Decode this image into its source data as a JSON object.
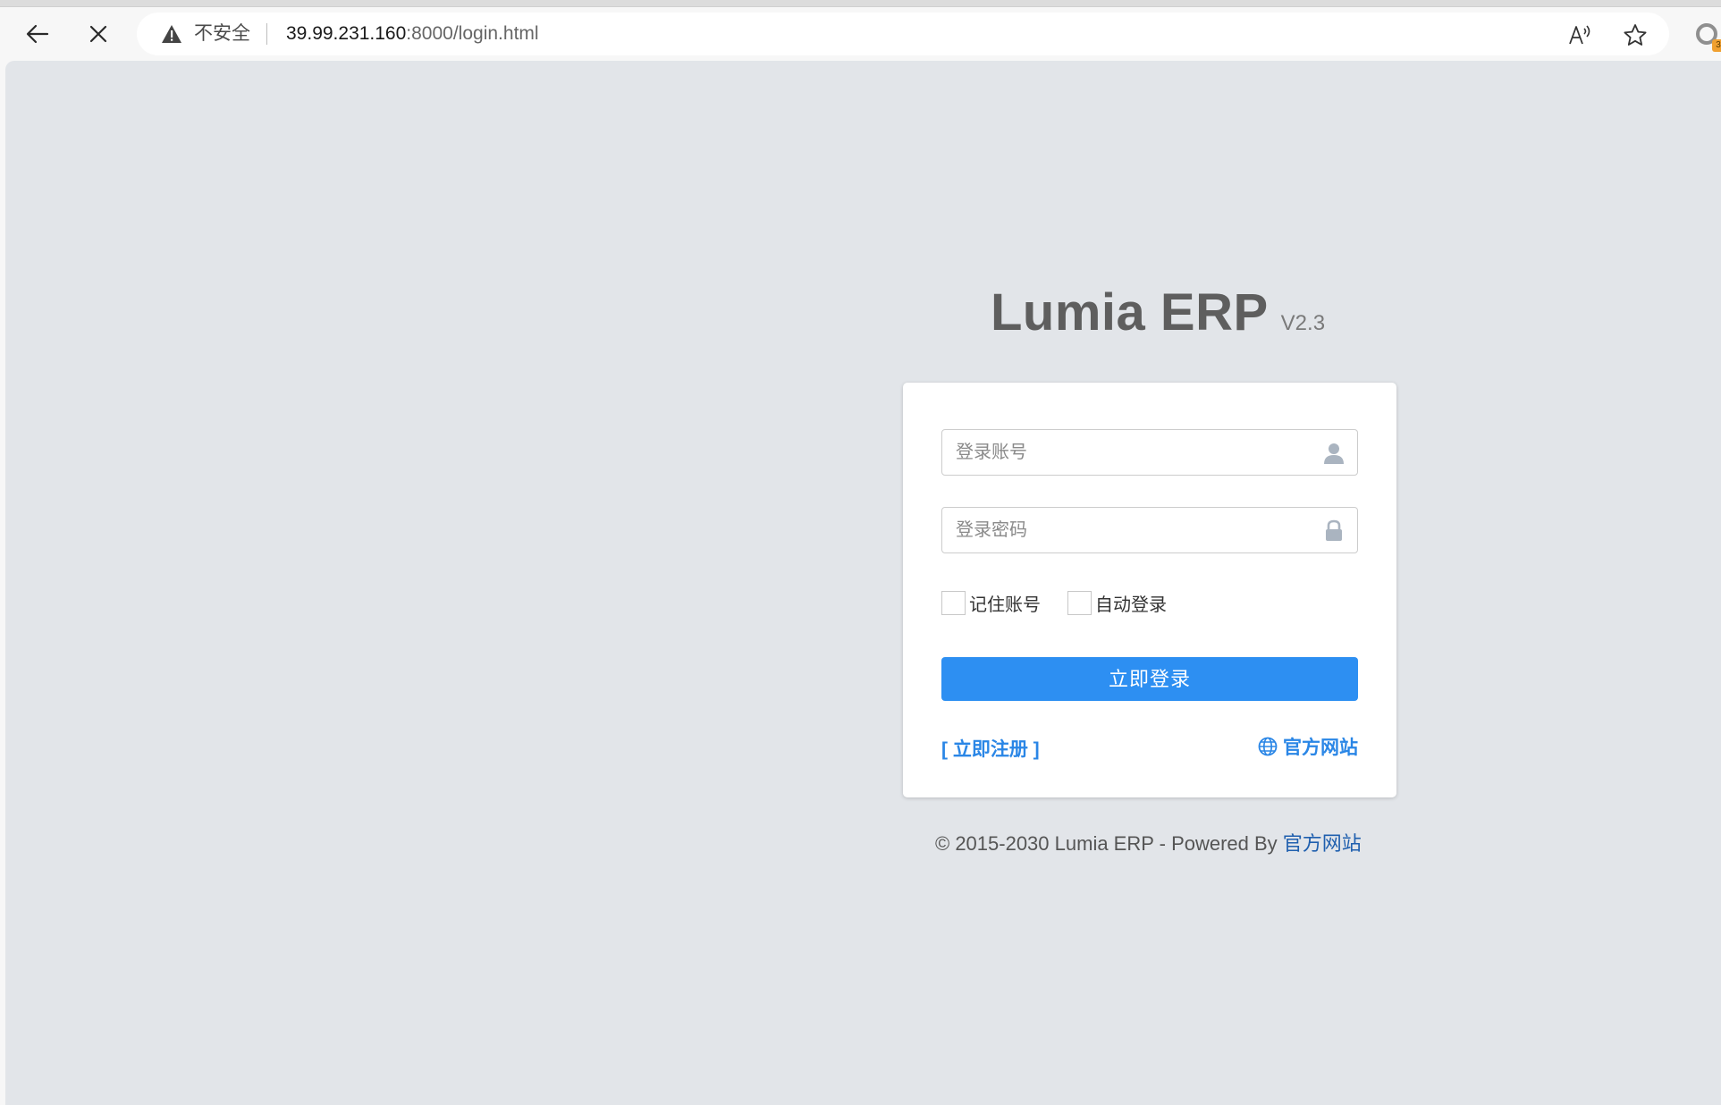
{
  "browser": {
    "security_label": "不安全",
    "url_host": "39.99.231.160",
    "url_rest": ":8000/login.html",
    "icons": {
      "back": "back-arrow-icon",
      "stop": "close-icon",
      "warning": "warning-icon",
      "read_aloud": "read-aloud-icon",
      "favorite": "star-icon",
      "profile": "profile-icon"
    },
    "profile_badge": "3"
  },
  "brand": {
    "title": "Lumia ERP",
    "version": "V2.3"
  },
  "login": {
    "username_placeholder": "登录账号",
    "password_placeholder": "登录密码",
    "remember_label": "记住账号",
    "auto_login_label": "自动登录",
    "submit_label": "立即登录",
    "register_label": "[ 立即注册 ]",
    "website_label": "官方网站"
  },
  "footer": {
    "text": "© 2015-2030 Lumia ERP - Powered By ",
    "link_label": "官方网站"
  },
  "colors": {
    "page_bg": "#e2e5e9",
    "primary": "#2d8ff2",
    "link": "#2a86e6",
    "footer_link": "#1f5fae"
  }
}
